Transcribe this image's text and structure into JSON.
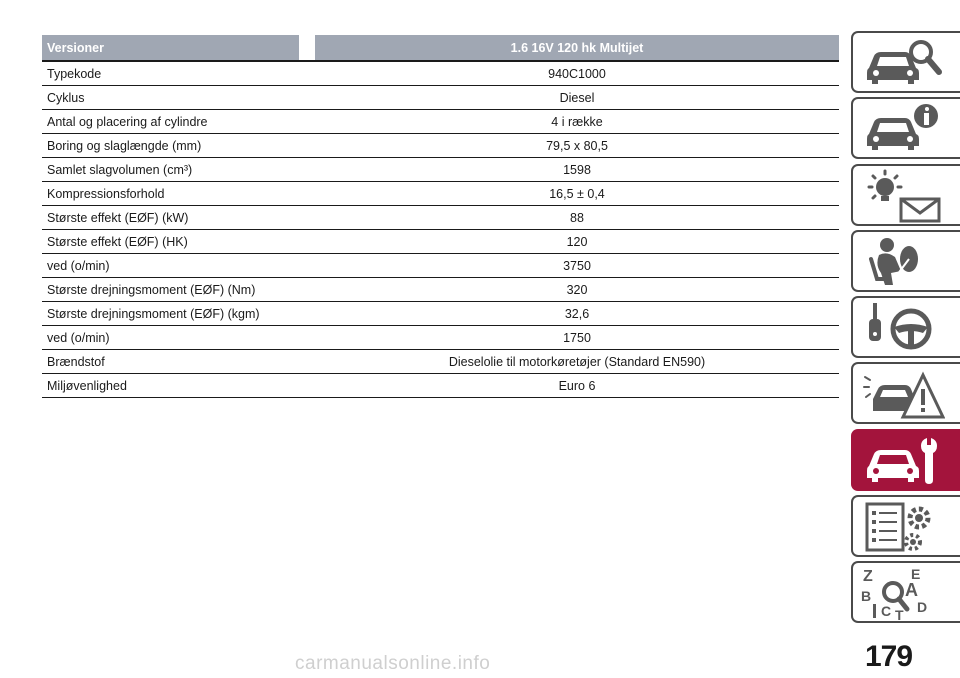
{
  "table": {
    "header": {
      "label": "Versioner",
      "value": "1.6 16V 120 hk Multijet"
    },
    "rows": [
      {
        "label": "Typekode",
        "value": "940C1000"
      },
      {
        "label": "Cyklus",
        "value": "Diesel"
      },
      {
        "label": "Antal og placering af cylindre",
        "value": "4 i række"
      },
      {
        "label": "Boring og slaglængde (mm)",
        "value": "79,5 x 80,5"
      },
      {
        "label": "Samlet slagvolumen (cm³)",
        "value": "1598"
      },
      {
        "label": "Kompressionsforhold",
        "value": "16,5 ± 0,4"
      },
      {
        "label": "Største effekt (EØF) (kW)",
        "value": "88"
      },
      {
        "label": "Største effekt (EØF) (HK)",
        "value": "120"
      },
      {
        "label": "ved (o/min)",
        "value": "3750"
      },
      {
        "label": "Største drejningsmoment (EØF) (Nm)",
        "value": "320"
      },
      {
        "label": "Største drejningsmoment (EØF) (kgm)",
        "value": "32,6"
      },
      {
        "label": "ved (o/min)",
        "value": "1750"
      },
      {
        "label": "Brændstof",
        "value": "Dieselolie til motorkøretøjer (Standard EN590)"
      },
      {
        "label": "Miljøvenlighed",
        "value": "Euro 6"
      }
    ]
  },
  "tabs": [
    {
      "icon": "car-search-icon",
      "active": false
    },
    {
      "icon": "car-info-icon",
      "active": false
    },
    {
      "icon": "warning-light-message-icon",
      "active": false
    },
    {
      "icon": "airbag-seat-icon",
      "active": false
    },
    {
      "icon": "key-steering-wheel-icon",
      "active": false
    },
    {
      "icon": "car-accident-warning-icon",
      "active": false
    },
    {
      "icon": "car-wrench-icon",
      "active": true
    },
    {
      "icon": "checklist-gear-icon",
      "active": false
    },
    {
      "icon": "index-search-icon",
      "active": false
    }
  ],
  "index_letters": [
    "Z",
    "E",
    "A",
    "B",
    "C",
    "D",
    "T"
  ],
  "page_number": "179",
  "watermark": "carmanualsonline.info",
  "colors": {
    "header_bg": "#a0a7b3",
    "accent": "#a3143c",
    "tab_border": "#4a4a4a"
  }
}
